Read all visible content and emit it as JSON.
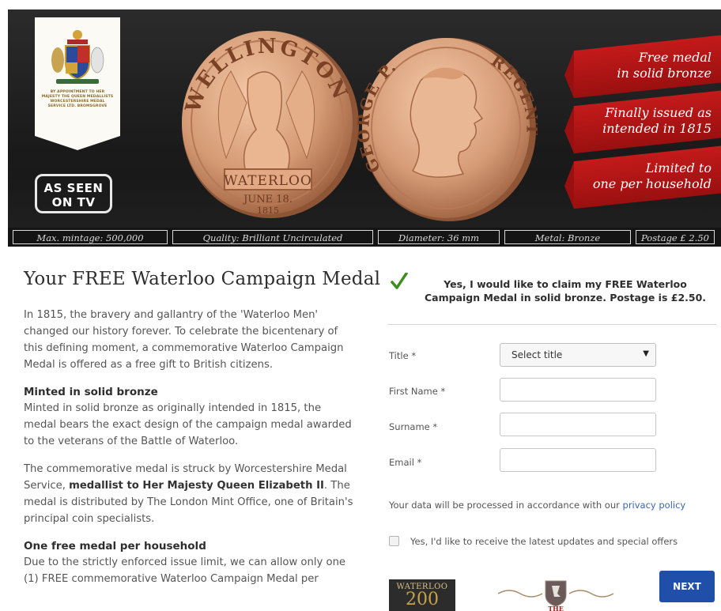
{
  "hero": {
    "crest_text": "BY APPOINTMENT TO HER MAJESTY THE QUEEN MEDALLISTS WORCESTERSHIRE MEDAL SERVICE LTD. BROMSGROVE",
    "tv_badge": [
      "AS SEEN",
      "ON TV"
    ],
    "coin_left": {
      "legend": "WELLINGTON",
      "band": "WATERLOO",
      "date_line1": "JUNE 18.",
      "date_line2": "1815"
    },
    "coin_right": {
      "legend_left": "GEORGE P.",
      "legend_right": "REGENT"
    },
    "ribbons": [
      [
        "Free medal",
        "in solid bronze"
      ],
      [
        "Finally issued as",
        "intended in 1815"
      ],
      [
        "Limited to",
        "one per household"
      ]
    ],
    "specs": [
      "Max. mintage: 500,000",
      "Quality: Brilliant Uncirculated",
      "Diameter: 36 mm",
      "Metal: Bronze",
      "Postage £ 2.50"
    ],
    "colors": {
      "ribbon": "#c41a1a",
      "bronze": "#d9a07a",
      "dark": "#1e1e1e"
    }
  },
  "content": {
    "title": "Your FREE Waterloo Campaign Medal",
    "intro": "In 1815, the bravery and gallantry of the 'Waterloo Men' changed our history forever. To celebrate the bicentenary of this defining moment, a commemorative Waterloo Campaign Medal is offered as a free gift to British citizens.",
    "sections": [
      {
        "heading": "Minted in solid bronze",
        "text": "Minted in solid bronze as originally intended in 1815, the medal bears the exact design of the campaign medal awarded to the veterans of the Battle of Waterloo."
      }
    ],
    "para3_pre": "The commemorative medal is struck by Worcestershire Medal Service, ",
    "para3_bold": "medallist to Her Majesty Queen Elizabeth II",
    "para3_post": ". The medal is distributed by The London Mint Office, one of Britain's principal coin specialists.",
    "section2_heading": "One free medal per household",
    "section2_text": "Due to the strictly enforced issue limit, we can allow only one (1) FREE commemorative Waterloo Campaign Medal per"
  },
  "form": {
    "claim_text": "Yes, I would like to claim my FREE Waterloo Campaign Medal in solid bronze. Postage is £2.50.",
    "fields": {
      "title_label": "Title",
      "first_name_label": "First Name",
      "surname_label": "Surname",
      "email_label": "Email",
      "required_mark": "*",
      "title_value": "Select title",
      "first_name_value": "",
      "surname_value": "",
      "email_value": ""
    },
    "privacy_pre": "Your data will be processed in accordance with our ",
    "privacy_link": "privacy policy",
    "optin_text": "Yes, I'd like to receive the latest updates and special offers",
    "next_label": "NEXT",
    "check_color": "#3e8e1e",
    "button_color": "#1f4fa8"
  },
  "footer_logos": {
    "waterloo200_top": "WATERLOO",
    "waterloo200_big": "200",
    "mint_text": "THE"
  }
}
